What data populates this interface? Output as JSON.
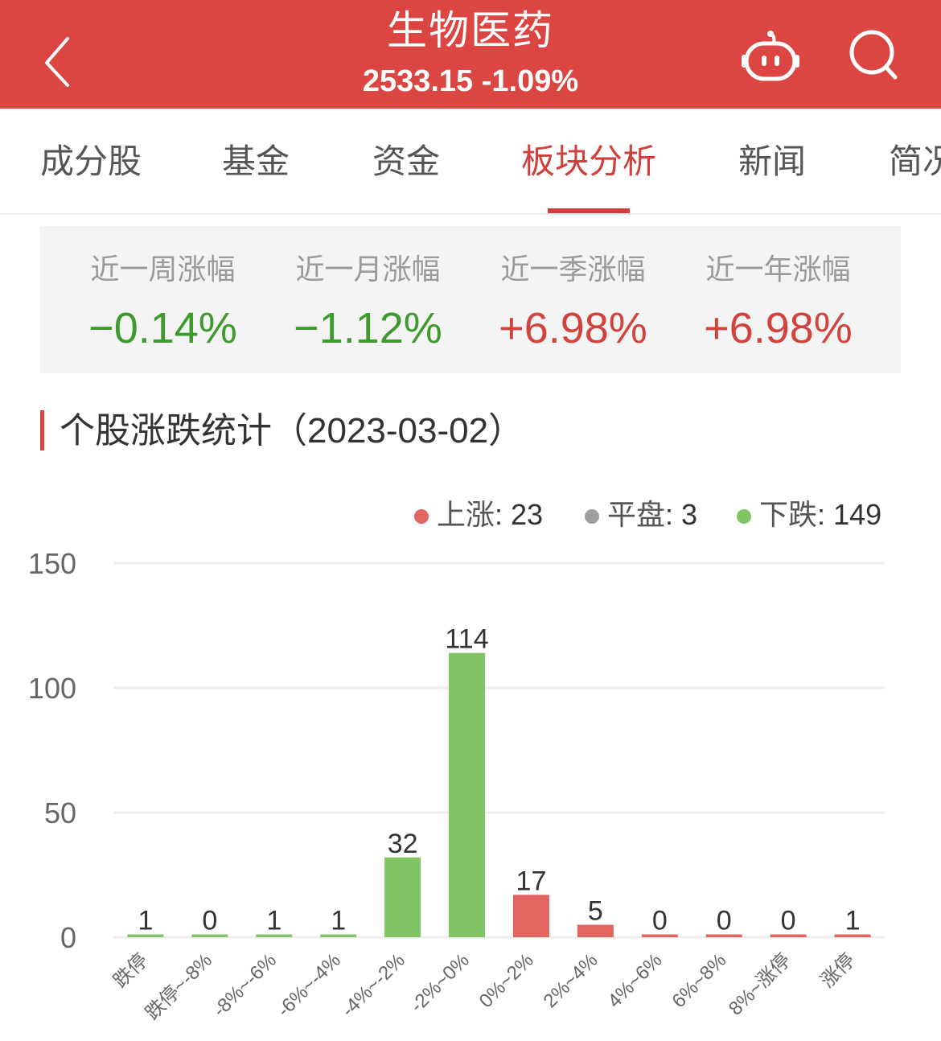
{
  "header": {
    "title": "生物医药",
    "subtitle": "2533.15 -1.09%",
    "back_icon": "chevron-left-icon",
    "bot_icon": "robot-icon",
    "search_icon": "search-icon",
    "background_color": "#dc4642"
  },
  "tabs": [
    {
      "label": "成分股",
      "active": false
    },
    {
      "label": "基金",
      "active": false
    },
    {
      "label": "资金",
      "active": false
    },
    {
      "label": "板块分析",
      "active": true
    },
    {
      "label": "新闻",
      "active": false
    },
    {
      "label": "简况",
      "active": false
    }
  ],
  "stats": [
    {
      "label": "近一周涨幅",
      "value": "−0.14%",
      "direction": "down"
    },
    {
      "label": "近一月涨幅",
      "value": "−1.12%",
      "direction": "down"
    },
    {
      "label": "近一季涨幅",
      "value": "+6.98%",
      "direction": "up"
    },
    {
      "label": "近一年涨幅",
      "value": "+6.98%",
      "direction": "up"
    }
  ],
  "section": {
    "title": "个股涨跌统计（2023-03-02）"
  },
  "legend": [
    {
      "name": "上涨",
      "value": "23",
      "color": "#e0665f"
    },
    {
      "name": "平盘",
      "value": "3",
      "color": "#9e9e9e"
    },
    {
      "name": "下跌",
      "value": "149",
      "color": "#82c464"
    }
  ],
  "colors": {
    "up": "#e0665f",
    "down": "#82c464",
    "grid": "#eeeeee",
    "accent": "#dc4642"
  },
  "chart_data": {
    "type": "bar",
    "title": "个股涨跌统计（2023-03-02）",
    "xlabel": "",
    "ylabel": "",
    "ylim": [
      0,
      150
    ],
    "yticks": [
      0,
      50,
      100,
      150
    ],
    "grid": true,
    "legend_position": "top-right",
    "categories": [
      "跌停",
      "跌停~-8%",
      "-8%~-6%",
      "-6%~-4%",
      "-4%~-2%",
      "-2%~0%",
      "0%~2%",
      "2%~4%",
      "4%~6%",
      "6%~8%",
      "8%~涨停",
      "涨停"
    ],
    "values": [
      1,
      0,
      1,
      1,
      32,
      114,
      17,
      5,
      0,
      0,
      0,
      1
    ],
    "bar_colors": [
      "down",
      "down",
      "down",
      "down",
      "down",
      "down",
      "up",
      "up",
      "up",
      "up",
      "up",
      "up"
    ]
  }
}
